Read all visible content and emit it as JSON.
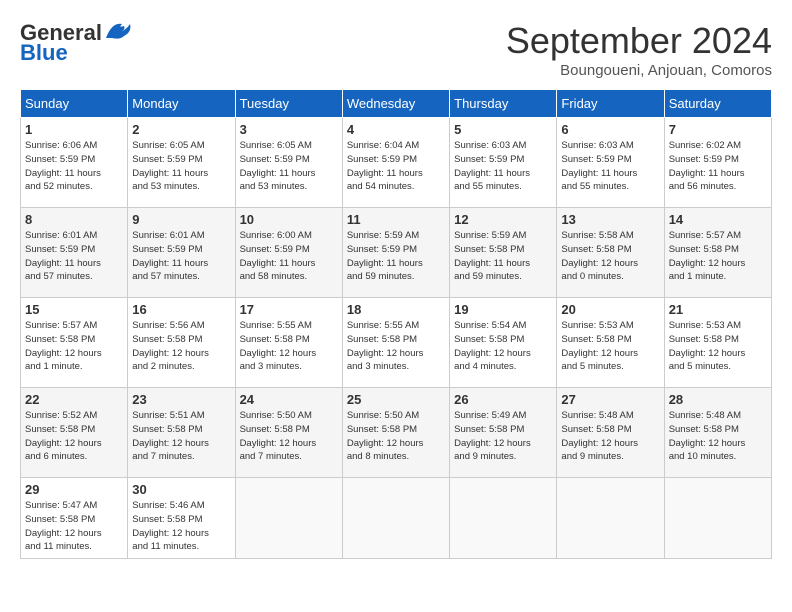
{
  "header": {
    "logo_general": "General",
    "logo_blue": "Blue",
    "month_title": "September 2024",
    "location": "Boungoueni, Anjouan, Comoros"
  },
  "days_of_week": [
    "Sunday",
    "Monday",
    "Tuesday",
    "Wednesday",
    "Thursday",
    "Friday",
    "Saturday"
  ],
  "weeks": [
    [
      {
        "day": "1",
        "info": "Sunrise: 6:06 AM\nSunset: 5:59 PM\nDaylight: 11 hours\nand 52 minutes."
      },
      {
        "day": "2",
        "info": "Sunrise: 6:05 AM\nSunset: 5:59 PM\nDaylight: 11 hours\nand 53 minutes."
      },
      {
        "day": "3",
        "info": "Sunrise: 6:05 AM\nSunset: 5:59 PM\nDaylight: 11 hours\nand 53 minutes."
      },
      {
        "day": "4",
        "info": "Sunrise: 6:04 AM\nSunset: 5:59 PM\nDaylight: 11 hours\nand 54 minutes."
      },
      {
        "day": "5",
        "info": "Sunrise: 6:03 AM\nSunset: 5:59 PM\nDaylight: 11 hours\nand 55 minutes."
      },
      {
        "day": "6",
        "info": "Sunrise: 6:03 AM\nSunset: 5:59 PM\nDaylight: 11 hours\nand 55 minutes."
      },
      {
        "day": "7",
        "info": "Sunrise: 6:02 AM\nSunset: 5:59 PM\nDaylight: 11 hours\nand 56 minutes."
      }
    ],
    [
      {
        "day": "8",
        "info": "Sunrise: 6:01 AM\nSunset: 5:59 PM\nDaylight: 11 hours\nand 57 minutes."
      },
      {
        "day": "9",
        "info": "Sunrise: 6:01 AM\nSunset: 5:59 PM\nDaylight: 11 hours\nand 57 minutes."
      },
      {
        "day": "10",
        "info": "Sunrise: 6:00 AM\nSunset: 5:59 PM\nDaylight: 11 hours\nand 58 minutes."
      },
      {
        "day": "11",
        "info": "Sunrise: 5:59 AM\nSunset: 5:59 PM\nDaylight: 11 hours\nand 59 minutes."
      },
      {
        "day": "12",
        "info": "Sunrise: 5:59 AM\nSunset: 5:58 PM\nDaylight: 11 hours\nand 59 minutes."
      },
      {
        "day": "13",
        "info": "Sunrise: 5:58 AM\nSunset: 5:58 PM\nDaylight: 12 hours\nand 0 minutes."
      },
      {
        "day": "14",
        "info": "Sunrise: 5:57 AM\nSunset: 5:58 PM\nDaylight: 12 hours\nand 1 minute."
      }
    ],
    [
      {
        "day": "15",
        "info": "Sunrise: 5:57 AM\nSunset: 5:58 PM\nDaylight: 12 hours\nand 1 minute."
      },
      {
        "day": "16",
        "info": "Sunrise: 5:56 AM\nSunset: 5:58 PM\nDaylight: 12 hours\nand 2 minutes."
      },
      {
        "day": "17",
        "info": "Sunrise: 5:55 AM\nSunset: 5:58 PM\nDaylight: 12 hours\nand 3 minutes."
      },
      {
        "day": "18",
        "info": "Sunrise: 5:55 AM\nSunset: 5:58 PM\nDaylight: 12 hours\nand 3 minutes."
      },
      {
        "day": "19",
        "info": "Sunrise: 5:54 AM\nSunset: 5:58 PM\nDaylight: 12 hours\nand 4 minutes."
      },
      {
        "day": "20",
        "info": "Sunrise: 5:53 AM\nSunset: 5:58 PM\nDaylight: 12 hours\nand 5 minutes."
      },
      {
        "day": "21",
        "info": "Sunrise: 5:53 AM\nSunset: 5:58 PM\nDaylight: 12 hours\nand 5 minutes."
      }
    ],
    [
      {
        "day": "22",
        "info": "Sunrise: 5:52 AM\nSunset: 5:58 PM\nDaylight: 12 hours\nand 6 minutes."
      },
      {
        "day": "23",
        "info": "Sunrise: 5:51 AM\nSunset: 5:58 PM\nDaylight: 12 hours\nand 7 minutes."
      },
      {
        "day": "24",
        "info": "Sunrise: 5:50 AM\nSunset: 5:58 PM\nDaylight: 12 hours\nand 7 minutes."
      },
      {
        "day": "25",
        "info": "Sunrise: 5:50 AM\nSunset: 5:58 PM\nDaylight: 12 hours\nand 8 minutes."
      },
      {
        "day": "26",
        "info": "Sunrise: 5:49 AM\nSunset: 5:58 PM\nDaylight: 12 hours\nand 9 minutes."
      },
      {
        "day": "27",
        "info": "Sunrise: 5:48 AM\nSunset: 5:58 PM\nDaylight: 12 hours\nand 9 minutes."
      },
      {
        "day": "28",
        "info": "Sunrise: 5:48 AM\nSunset: 5:58 PM\nDaylight: 12 hours\nand 10 minutes."
      }
    ],
    [
      {
        "day": "29",
        "info": "Sunrise: 5:47 AM\nSunset: 5:58 PM\nDaylight: 12 hours\nand 11 minutes."
      },
      {
        "day": "30",
        "info": "Sunrise: 5:46 AM\nSunset: 5:58 PM\nDaylight: 12 hours\nand 11 minutes."
      },
      {
        "day": "",
        "info": ""
      },
      {
        "day": "",
        "info": ""
      },
      {
        "day": "",
        "info": ""
      },
      {
        "day": "",
        "info": ""
      },
      {
        "day": "",
        "info": ""
      }
    ]
  ]
}
